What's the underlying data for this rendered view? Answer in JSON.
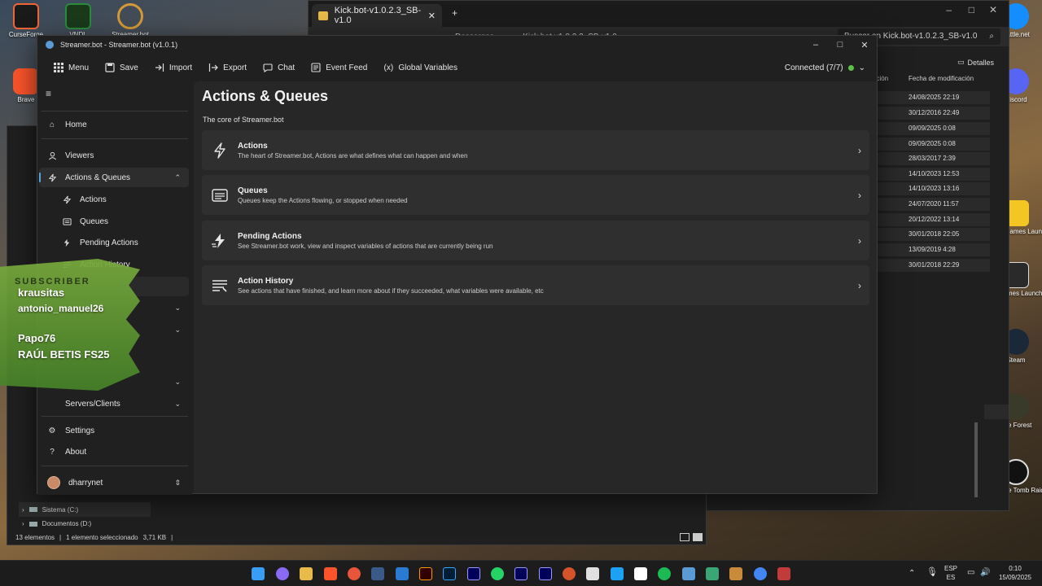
{
  "desktop": {
    "left_icons": [
      {
        "label": "CurseForge",
        "color": "#f16436"
      },
      {
        "label": "VNDL",
        "color": "#2b8a3e"
      },
      {
        "label": "Streamer.bot",
        "color": "#d49a3a"
      },
      {
        "label": "Brave",
        "color": "#fb542b"
      }
    ],
    "right_icons": [
      {
        "label": "Battle.net",
        "color": "#148eff"
      },
      {
        "label": "Discord",
        "color": "#5865f2"
      },
      {
        "label": "Rockstar Games Launcher",
        "color": "#f3c623"
      },
      {
        "label": "Epic Games Launcher",
        "color": "#2a2a2a"
      },
      {
        "label": "Steam",
        "color": "#1b2838"
      },
      {
        "label": "The Forest",
        "color": "#3a3a2a"
      },
      {
        "label": "Shadow of the Tomb Raider D...",
        "color": "#111111"
      }
    ]
  },
  "explorer_right": {
    "tab_title": "Kick.bot-v1.0.2.3_SB-v1.0",
    "breadcrumb": [
      "Descargas",
      "Kick.bot-v1.0.2.3_SB-v1.0"
    ],
    "search_placeholder": "Buscar en Kick.bot-v1.0.2.3_SB-v1.0",
    "details_label": "Detalles",
    "col_partial": "ación",
    "col_modified": "Fecha de modificación",
    "dates": [
      "24/08/2025 22:19",
      "30/12/2016 22:49",
      "09/09/2025 0:08",
      "09/09/2025 0:08",
      "28/03/2017 2:39",
      "14/10/2023 12:53",
      "14/10/2023 13:16",
      "24/07/2020 11:57",
      "20/12/2022 13:14",
      "30/01/2018 22:05",
      "13/09/2019 4:28",
      "30/01/2018 22:29"
    ]
  },
  "explorer_left": {
    "tree": [
      {
        "label": "Sistema (C:)"
      },
      {
        "label": "Documentos (D:)"
      }
    ],
    "status_count": "13 elementos",
    "status_selected": "1 elemento seleccionado",
    "status_size": "3,71 KB"
  },
  "window": {
    "title": "Streamer.bot - Streamer.bot (v1.0.1)"
  },
  "toolbar": {
    "menu": "Menu",
    "save": "Save",
    "import": "Import",
    "export": "Export",
    "chat": "Chat",
    "event_feed": "Event Feed",
    "global_variables": "Global Variables",
    "connected": "Connected (7/7)"
  },
  "sidebar": {
    "home": "Home",
    "viewers": "Viewers",
    "actions_queues": "Actions & Queues",
    "actions": "Actions",
    "queues": "Queues",
    "pending_actions": "Pending Actions",
    "action_history": "Action History",
    "servers_clients": "Servers/Clients",
    "settings": "Settings",
    "about": "About",
    "user": "dharrynet"
  },
  "content": {
    "title": "Actions & Queues",
    "subtitle": "The core of Streamer.bot",
    "cards": [
      {
        "title": "Actions",
        "desc": "The heart of Streamer.bot, Actions are what defines what can happen and when"
      },
      {
        "title": "Queues",
        "desc": "Queues keep the Actions flowing, or stopped when needed"
      },
      {
        "title": "Pending Actions",
        "desc": "See Streamer.bot work, view and inspect variables of actions that are currently being run"
      },
      {
        "title": "Action History",
        "desc": "See actions that have finished, and learn more about if they succeeded, what variables were available, etc"
      }
    ]
  },
  "overlay": {
    "title": "SUBSCRIBER",
    "names": [
      "krausitas",
      "antonio_manuel26",
      "Papo76",
      "RAÚL BETIS FS25"
    ]
  },
  "taskbar": {
    "lang_top": "ESP",
    "lang_bottom": "ES",
    "time": "0:10",
    "date": "15/09/2025"
  }
}
